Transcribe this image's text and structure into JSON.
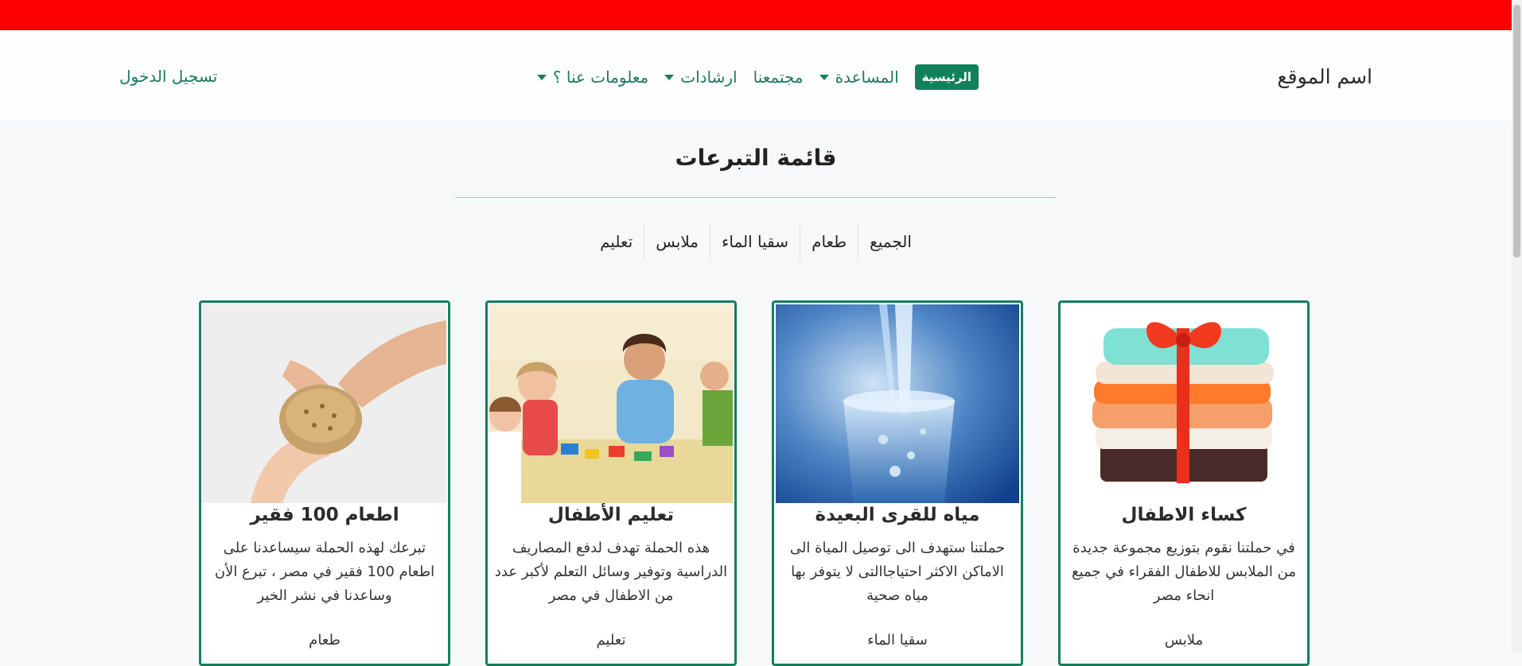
{
  "header": {
    "brand": "اسم الموقع",
    "login": "تسجيل الدخول",
    "nav": [
      {
        "label": "الرئيسية",
        "active": true,
        "dropdown": false
      },
      {
        "label": "المساعدة",
        "active": false,
        "dropdown": true
      },
      {
        "label": "مجتمعنا",
        "active": false,
        "dropdown": false
      },
      {
        "label": "ارشادات",
        "active": false,
        "dropdown": true
      },
      {
        "label": "معلومات عنا ؟",
        "active": false,
        "dropdown": true
      }
    ]
  },
  "main": {
    "title": "قائمة التبرعات",
    "filters": [
      "الجميع",
      "طعام",
      "سقيا الماء",
      "ملابس",
      "تعليم"
    ]
  },
  "cards": [
    {
      "title": "كساء الاطفال",
      "text": "في حملتنا نقوم بتوزيع مجموعة جديدة من الملابس للاطفال الفقراء في جميع انحاء مصر",
      "category": "ملابس",
      "image": "folded-clothes-image"
    },
    {
      "title": "مياه للقرى البعيدة",
      "text": "حملتنا ستهدف الى توصيل المياة الى الاماكن الاكثر احتياجاالتى لا يتوفر بها مياه صحية",
      "category": "سقيا الماء",
      "image": "water-glass-image"
    },
    {
      "title": "تعليم الأطفال",
      "text": "هذه الحملة تهدف لدفع المصاريف الدراسية وتوفير وسائل التعلم لأكبر عدد من الاطفال في مصر",
      "category": "تعليم",
      "image": "children-classroom-image"
    },
    {
      "title": "اطعام 100 فقير",
      "text": "تبرعك لهذه الحملة سيساعدنا على اطعام 100 فقير في مصر ، تبرع الأن وساعدنا في نشر الخير",
      "category": "طعام",
      "image": "bread-sharing-image"
    }
  ],
  "colors": {
    "top_bar": "#fe0000",
    "accent": "#12805c",
    "link": "#1a7a5e"
  }
}
